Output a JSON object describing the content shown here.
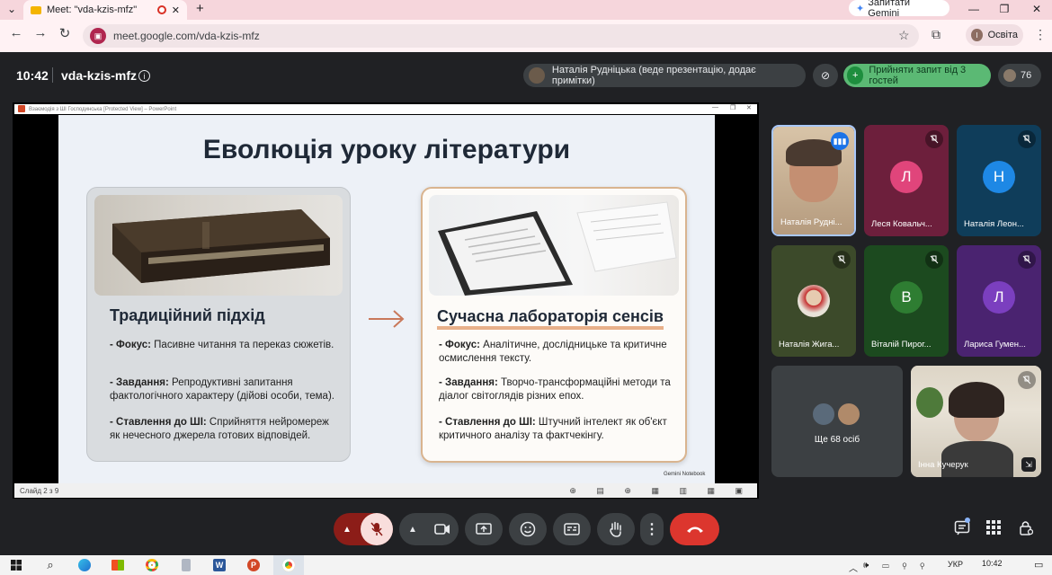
{
  "browser": {
    "tab_title": "Meet: \"vda-kzis-mfz\"",
    "gemini_label": "Запитати Gemini",
    "url": "meet.google.com/vda-kzis-mfz",
    "profile_initial": "І",
    "profile_label": "Освіта"
  },
  "meet": {
    "time": "10:42",
    "meeting_code": "vda-kzis-mfz",
    "presenter_label": "Наталія Рудніцька (веде презентацію, додає примітки)",
    "accept_label": "Прийняти запит від 3 гостей",
    "participant_count": "76"
  },
  "powerpoint": {
    "window_title": "Взаємодія з ШІ Господинська [Protected View] – PowerPoint",
    "status_text": "Слайд 2 з 9"
  },
  "slide": {
    "title": "Еволюція уроку літератури",
    "badge": "Gemini Notebook",
    "left": {
      "heading": "Традиційний підхід",
      "items": [
        {
          "label": "- Фокус:",
          "text": " Пасивне читання та переказ сюжетів."
        },
        {
          "label": "- Завдання:",
          "text": " Репродуктивні запитання фактологічного характеру (дійові особи, тема)."
        },
        {
          "label": "- Ставлення до ШІ:",
          "text": " Сприйняття нейромереж як нечесного джерела готових відповідей."
        }
      ]
    },
    "right": {
      "heading": "Сучасна лабораторія сенсів",
      "items": [
        {
          "label": "- Фокус:",
          "text": " Аналітичне, дослідницьке та критичне осмислення тексту."
        },
        {
          "label": "- Завдання:",
          "text": " Творчо-трансформаційні методи та діалог світоглядів різних епох."
        },
        {
          "label": "- Ставлення до ШІ:",
          "text": " Штучний інтелект як об'єкт критичного аналізу та фактчекінгу."
        }
      ]
    }
  },
  "tiles": [
    {
      "name": "Наталія Рудні...",
      "letter": "",
      "bg": "#c8b49a"
    },
    {
      "name": "Леся Ковальч...",
      "letter": "Л",
      "bg": "#6d1f3c",
      "avatar": "#e0457b"
    },
    {
      "name": "Наталія Леон...",
      "letter": "Н",
      "bg": "#0f3d5a",
      "avatar": "#1e88e5"
    },
    {
      "name": "Наталія Жига...",
      "letter": "",
      "bg": "#3c4a2a"
    },
    {
      "name": "Віталій Пирог...",
      "letter": "В",
      "bg": "#1c4a1f",
      "avatar": "#2e7d32"
    },
    {
      "name": "Лариса Гумен...",
      "letter": "Л",
      "bg": "#4a2370",
      "avatar": "#7b3fbf"
    },
    {
      "name": "Інна Кучерук",
      "letter": "",
      "bg": "#cfc7b8"
    }
  ],
  "more_label": "Ще 68 осіб",
  "taskbar": {
    "lang": "УКР",
    "clock_time": "10:42"
  }
}
